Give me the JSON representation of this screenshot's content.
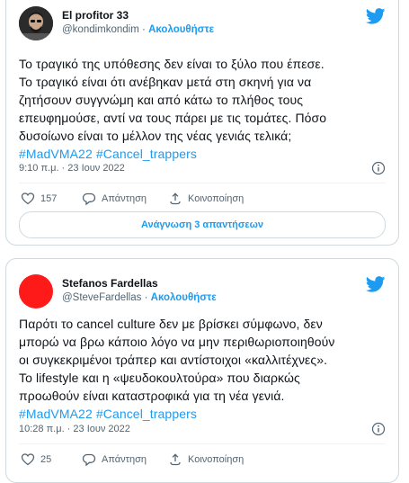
{
  "tweets": [
    {
      "author_name": "El profitor 33",
      "handle": "@kondimkondim",
      "separator": "·",
      "follow_label": "Ακολουθήστε",
      "lines": [
        "Το τραγικό της υπόθεσης δεν είναι το ξύλο που έπεσε.",
        "Το τραγικό είναι ότι ανέβηκαν μετά στη σκηνή για να",
        "ζητήσουν συγγνώμη και από κάτω το πλήθος τους",
        "επευφημούσε, αντί να τους πάρει με τις τομάτες. Πόσο",
        "δυσοίωνο είναι το μέλλον της νέας γενιάς τελικά;"
      ],
      "hashtags": [
        "#MadVMA22",
        "#Cancel_trappers"
      ],
      "timestamp": "9:10 π.μ. · 23 Ιουν 2022",
      "like_count": "157",
      "reply_label": "Απάντηση",
      "share_label": "Κοινοποίηση",
      "read_replies_label": "Ανάγνωση 3 απαντήσεων"
    },
    {
      "author_name": "Stefanos Fardellas",
      "handle": "@SteveFardellas",
      "separator": "·",
      "follow_label": "Ακολουθήστε",
      "lines": [
        "Παρότι το cancel culture δεν με βρίσκει σύμφωνο, δεν",
        "μπορώ να βρω κάποιο λόγο να μην περιθωριοποιηθούν",
        "οι συγκεκριμένοι τράπερ και αντίστοιχοι «καλλιτέχνες».",
        "Το lifestyle και η «ψευδοκουλτούρα» που διαρκώς",
        "προωθούν είναι καταστροφικά για τη νέα γενιά."
      ],
      "hashtags": [
        "#MadVMA22",
        "#Cancel_trappers"
      ],
      "timestamp": "10:28 π.μ. · 23 Ιουν 2022",
      "like_count": "25",
      "reply_label": "Απάντηση",
      "share_label": "Κοινοποίηση"
    }
  ],
  "colors": {
    "accent": "#1d9bf0",
    "muted": "#536471",
    "avatar2": "#ff1a1a"
  },
  "icons": [
    "twitter-bird-icon",
    "info-icon",
    "heart-icon",
    "reply-icon",
    "share-icon"
  ]
}
